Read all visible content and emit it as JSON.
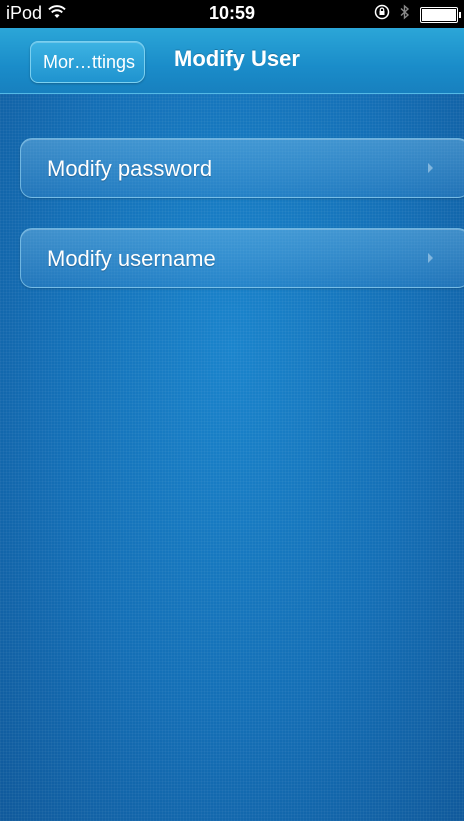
{
  "status_bar": {
    "device": "iPod",
    "time": "10:59",
    "icons": [
      "wifi-icon",
      "orientation-lock-icon",
      "bluetooth-icon",
      "battery-icon"
    ]
  },
  "nav": {
    "back_label": "Mor…ttings",
    "title": "Modify User"
  },
  "menu": {
    "items": [
      {
        "label": "Modify password"
      },
      {
        "label": "Modify username"
      }
    ]
  },
  "colors": {
    "nav_bar": "#1a8cc9",
    "content_bg": "#1474bd",
    "text": "#ffffff"
  }
}
